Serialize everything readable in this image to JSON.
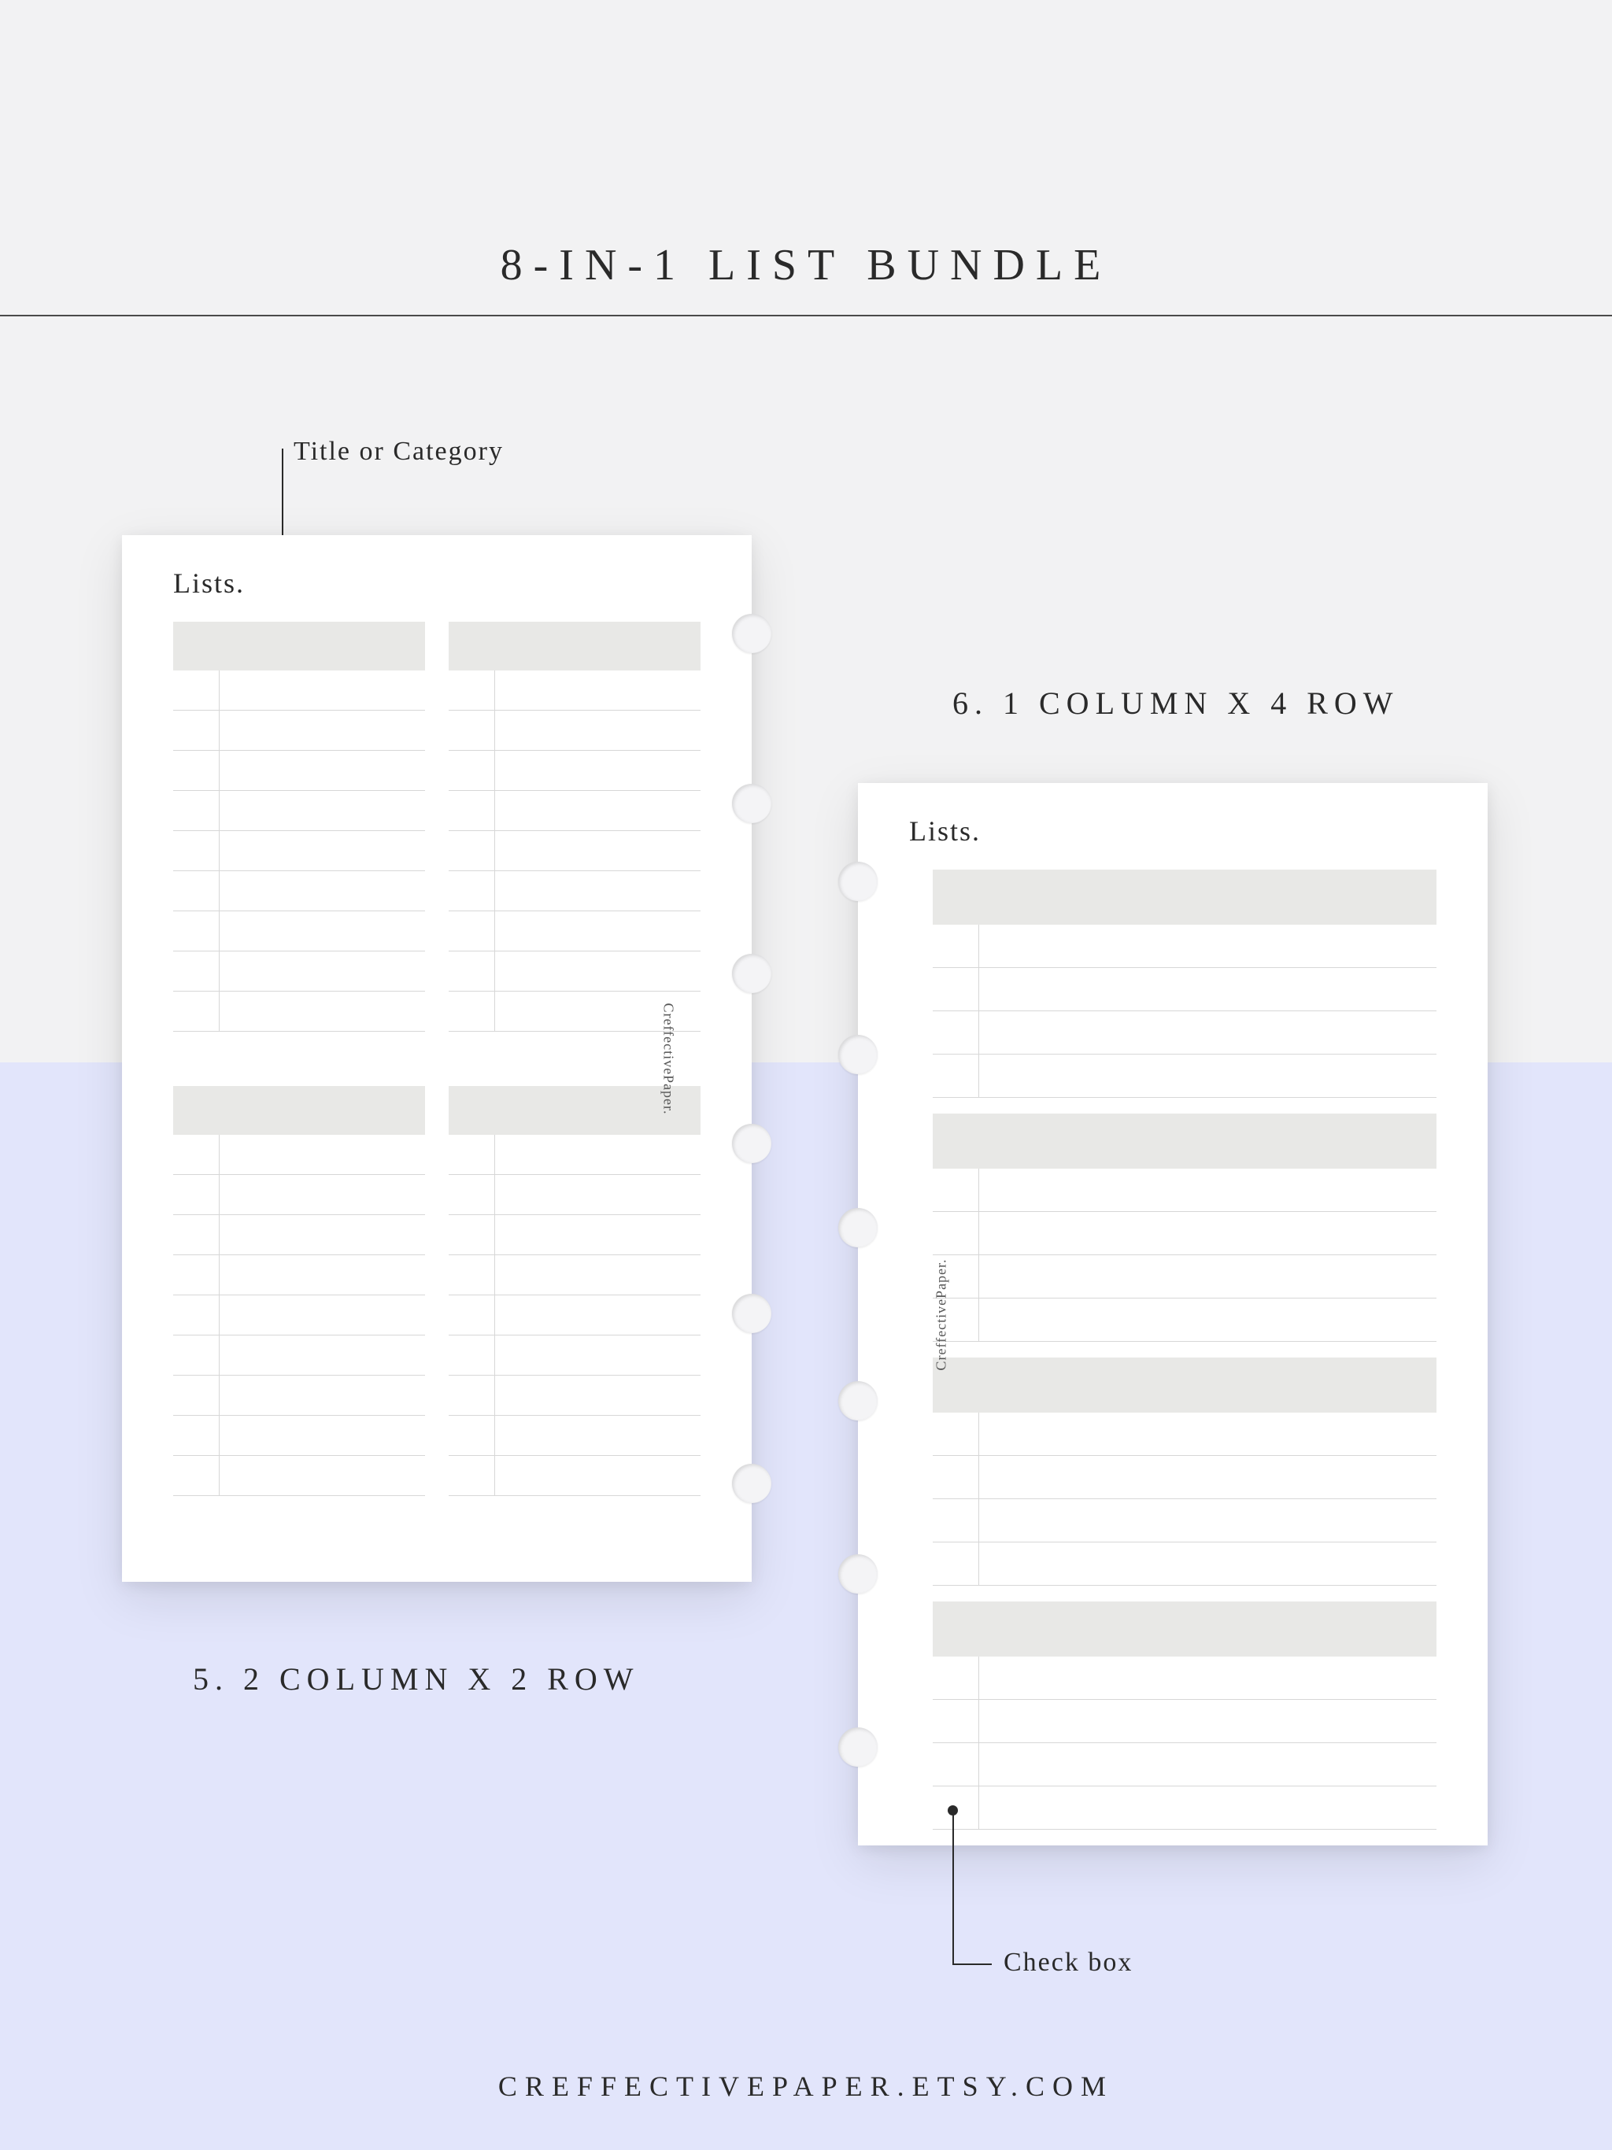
{
  "title": "8-IN-1 LIST BUNDLE",
  "callouts": {
    "title_or_category": "Title or Category",
    "check_box": "Check box"
  },
  "pages": {
    "left": {
      "heading": "Lists.",
      "caption": "5. 2 COLUMN X 2 ROW",
      "watermark": "CreffectivePaper.",
      "blocks_per_row_lines": 9
    },
    "right": {
      "heading": "Lists.",
      "caption": "6. 1 COLUMN X 4 ROW",
      "watermark": "CreffectivePaper.",
      "blocks_lines": 4
    }
  },
  "footer": "CREFFECTIVEPAPER.ETSY.COM"
}
